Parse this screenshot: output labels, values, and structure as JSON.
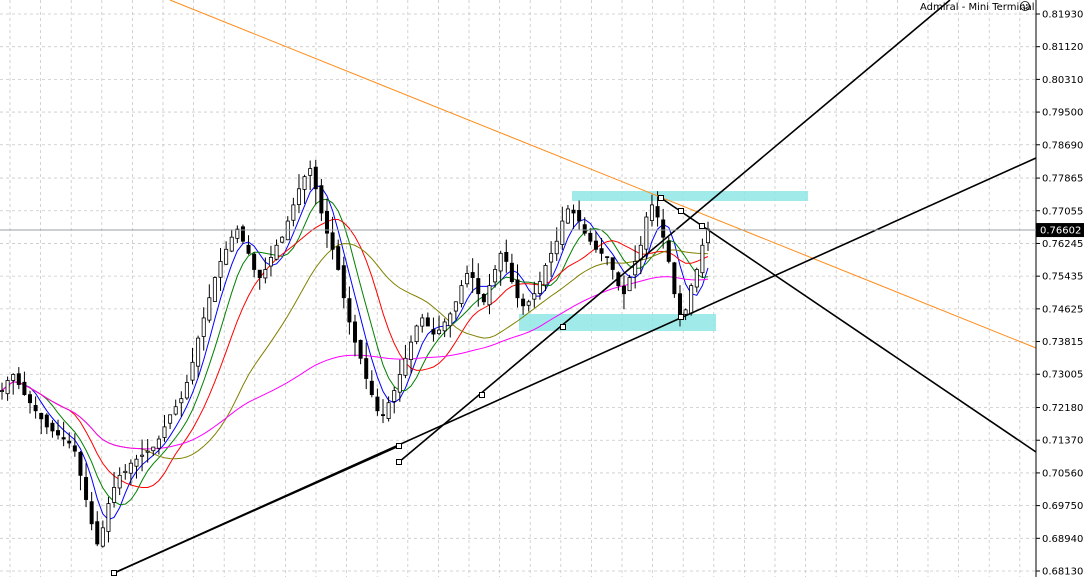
{
  "branding": {
    "text": "Admiral - Mini Terminal",
    "icon": "smiley-icon"
  },
  "chart_data": {
    "type": "line",
    "title": "",
    "grid": true,
    "grid_style": "dashed",
    "background": "#ffffff",
    "y_axis": {
      "side": "right",
      "ticks": [
        "0.81930",
        "0.81120",
        "0.80310",
        "0.79500",
        "0.78690",
        "0.77865",
        "0.77055",
        "0.76245",
        "0.75435",
        "0.74625",
        "0.73815",
        "0.73005",
        "0.72180",
        "0.71370",
        "0.70560",
        "0.69750",
        "0.68940",
        "0.68130"
      ],
      "ylim": [
        0.6813,
        0.8193
      ]
    },
    "current_price": "0.76602",
    "candles_close_sketch": [
      0.726,
      0.7285,
      0.73,
      0.7275,
      0.725,
      0.723,
      0.721,
      0.719,
      0.717,
      0.716,
      0.715,
      0.714,
      0.713,
      0.711,
      0.705,
      0.699,
      0.693,
      0.688,
      0.692,
      0.698,
      0.702,
      0.705,
      0.706,
      0.708,
      0.709,
      0.71,
      0.711,
      0.712,
      0.714,
      0.717,
      0.72,
      0.722,
      0.724,
      0.728,
      0.733,
      0.739,
      0.744,
      0.749,
      0.754,
      0.758,
      0.761,
      0.764,
      0.766,
      0.763,
      0.76,
      0.756,
      0.754,
      0.756,
      0.759,
      0.762,
      0.764,
      0.768,
      0.772,
      0.776,
      0.779,
      0.781,
      0.776,
      0.77,
      0.765,
      0.761,
      0.756,
      0.749,
      0.743,
      0.738,
      0.734,
      0.729,
      0.725,
      0.721,
      0.72,
      0.723,
      0.726,
      0.73,
      0.734,
      0.738,
      0.742,
      0.744,
      0.742,
      0.74,
      0.741,
      0.743,
      0.745,
      0.748,
      0.752,
      0.755,
      0.754,
      0.75,
      0.748,
      0.752,
      0.756,
      0.76,
      0.758,
      0.753,
      0.749,
      0.747,
      0.748,
      0.75,
      0.753,
      0.757,
      0.76,
      0.763,
      0.768,
      0.771,
      0.77,
      0.768,
      0.765,
      0.763,
      0.761,
      0.76,
      0.759,
      0.756,
      0.752,
      0.75,
      0.754,
      0.758,
      0.762,
      0.769,
      0.772,
      0.769,
      0.764,
      0.758,
      0.75,
      0.744,
      0.746,
      0.752,
      0.756,
      0.762,
      0.766
    ],
    "moving_averages": [
      {
        "color": "#0000ff",
        "period_hint": "fast"
      },
      {
        "color": "#008000",
        "period_hint": "medium"
      },
      {
        "color": "#ff0000",
        "period_hint": "medium"
      },
      {
        "color": "#808000",
        "period_hint": "slow"
      },
      {
        "color": "#ff00ff",
        "period_hint": "slowest"
      }
    ],
    "zones": [
      {
        "color": "#8fe6e6",
        "price_top": 0.7755,
        "price_bottom": 0.7745
      },
      {
        "color": "#8fe6e6",
        "price_top": 0.745,
        "price_bottom": 0.743
      }
    ],
    "trend_lines": [
      {
        "color": "#ff8c1a"
      },
      {
        "color": "#000000"
      },
      {
        "color": "#000000"
      },
      {
        "color": "#000000"
      },
      {
        "color": "#000000"
      }
    ]
  }
}
